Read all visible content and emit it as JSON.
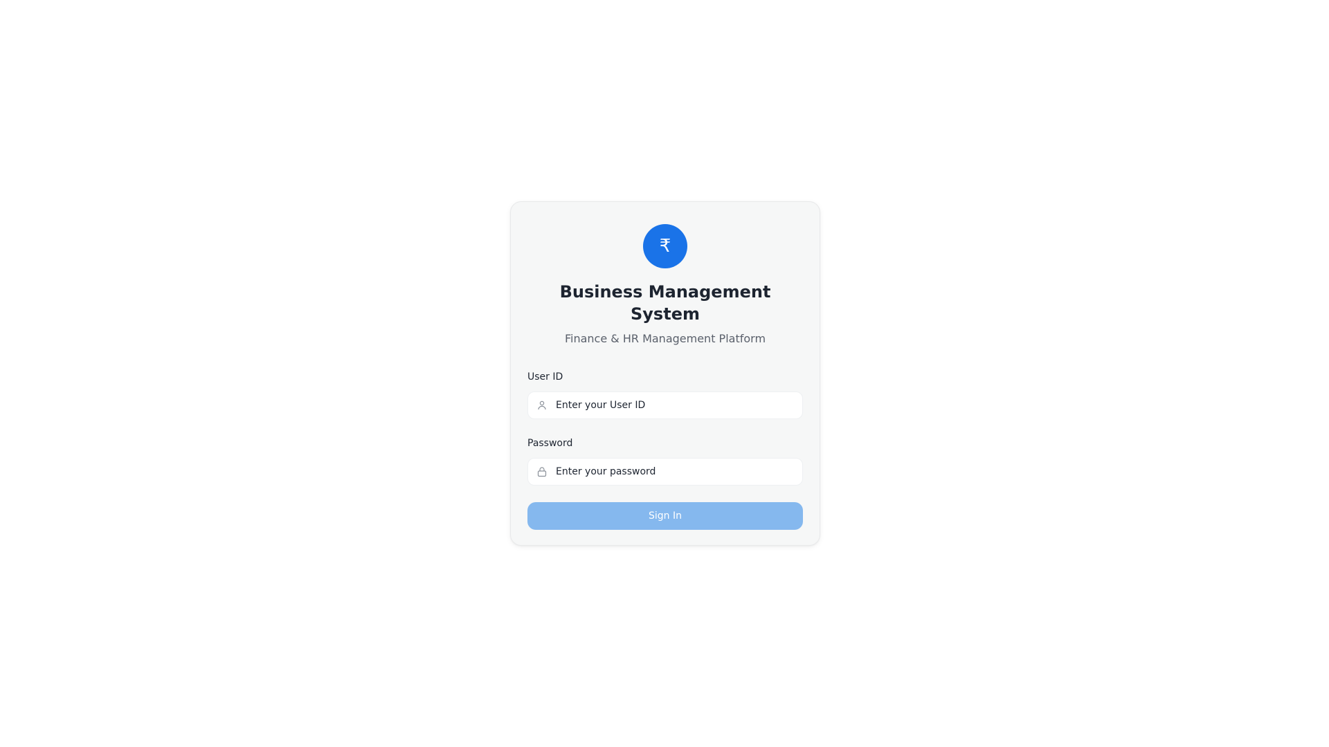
{
  "brand": {
    "logo_symbol": "₹",
    "logo_color": "#1a73e8",
    "title": "Business Management System",
    "subtitle": "Finance & HR Management Platform"
  },
  "form": {
    "user_id": {
      "label": "User ID",
      "placeholder": "Enter your User ID",
      "value": "",
      "icon": "user-icon"
    },
    "password": {
      "label": "Password",
      "placeholder": "Enter your password",
      "value": "",
      "icon": "lock-icon"
    },
    "submit": {
      "label": "Sign In",
      "color": "#85b8ee"
    }
  }
}
